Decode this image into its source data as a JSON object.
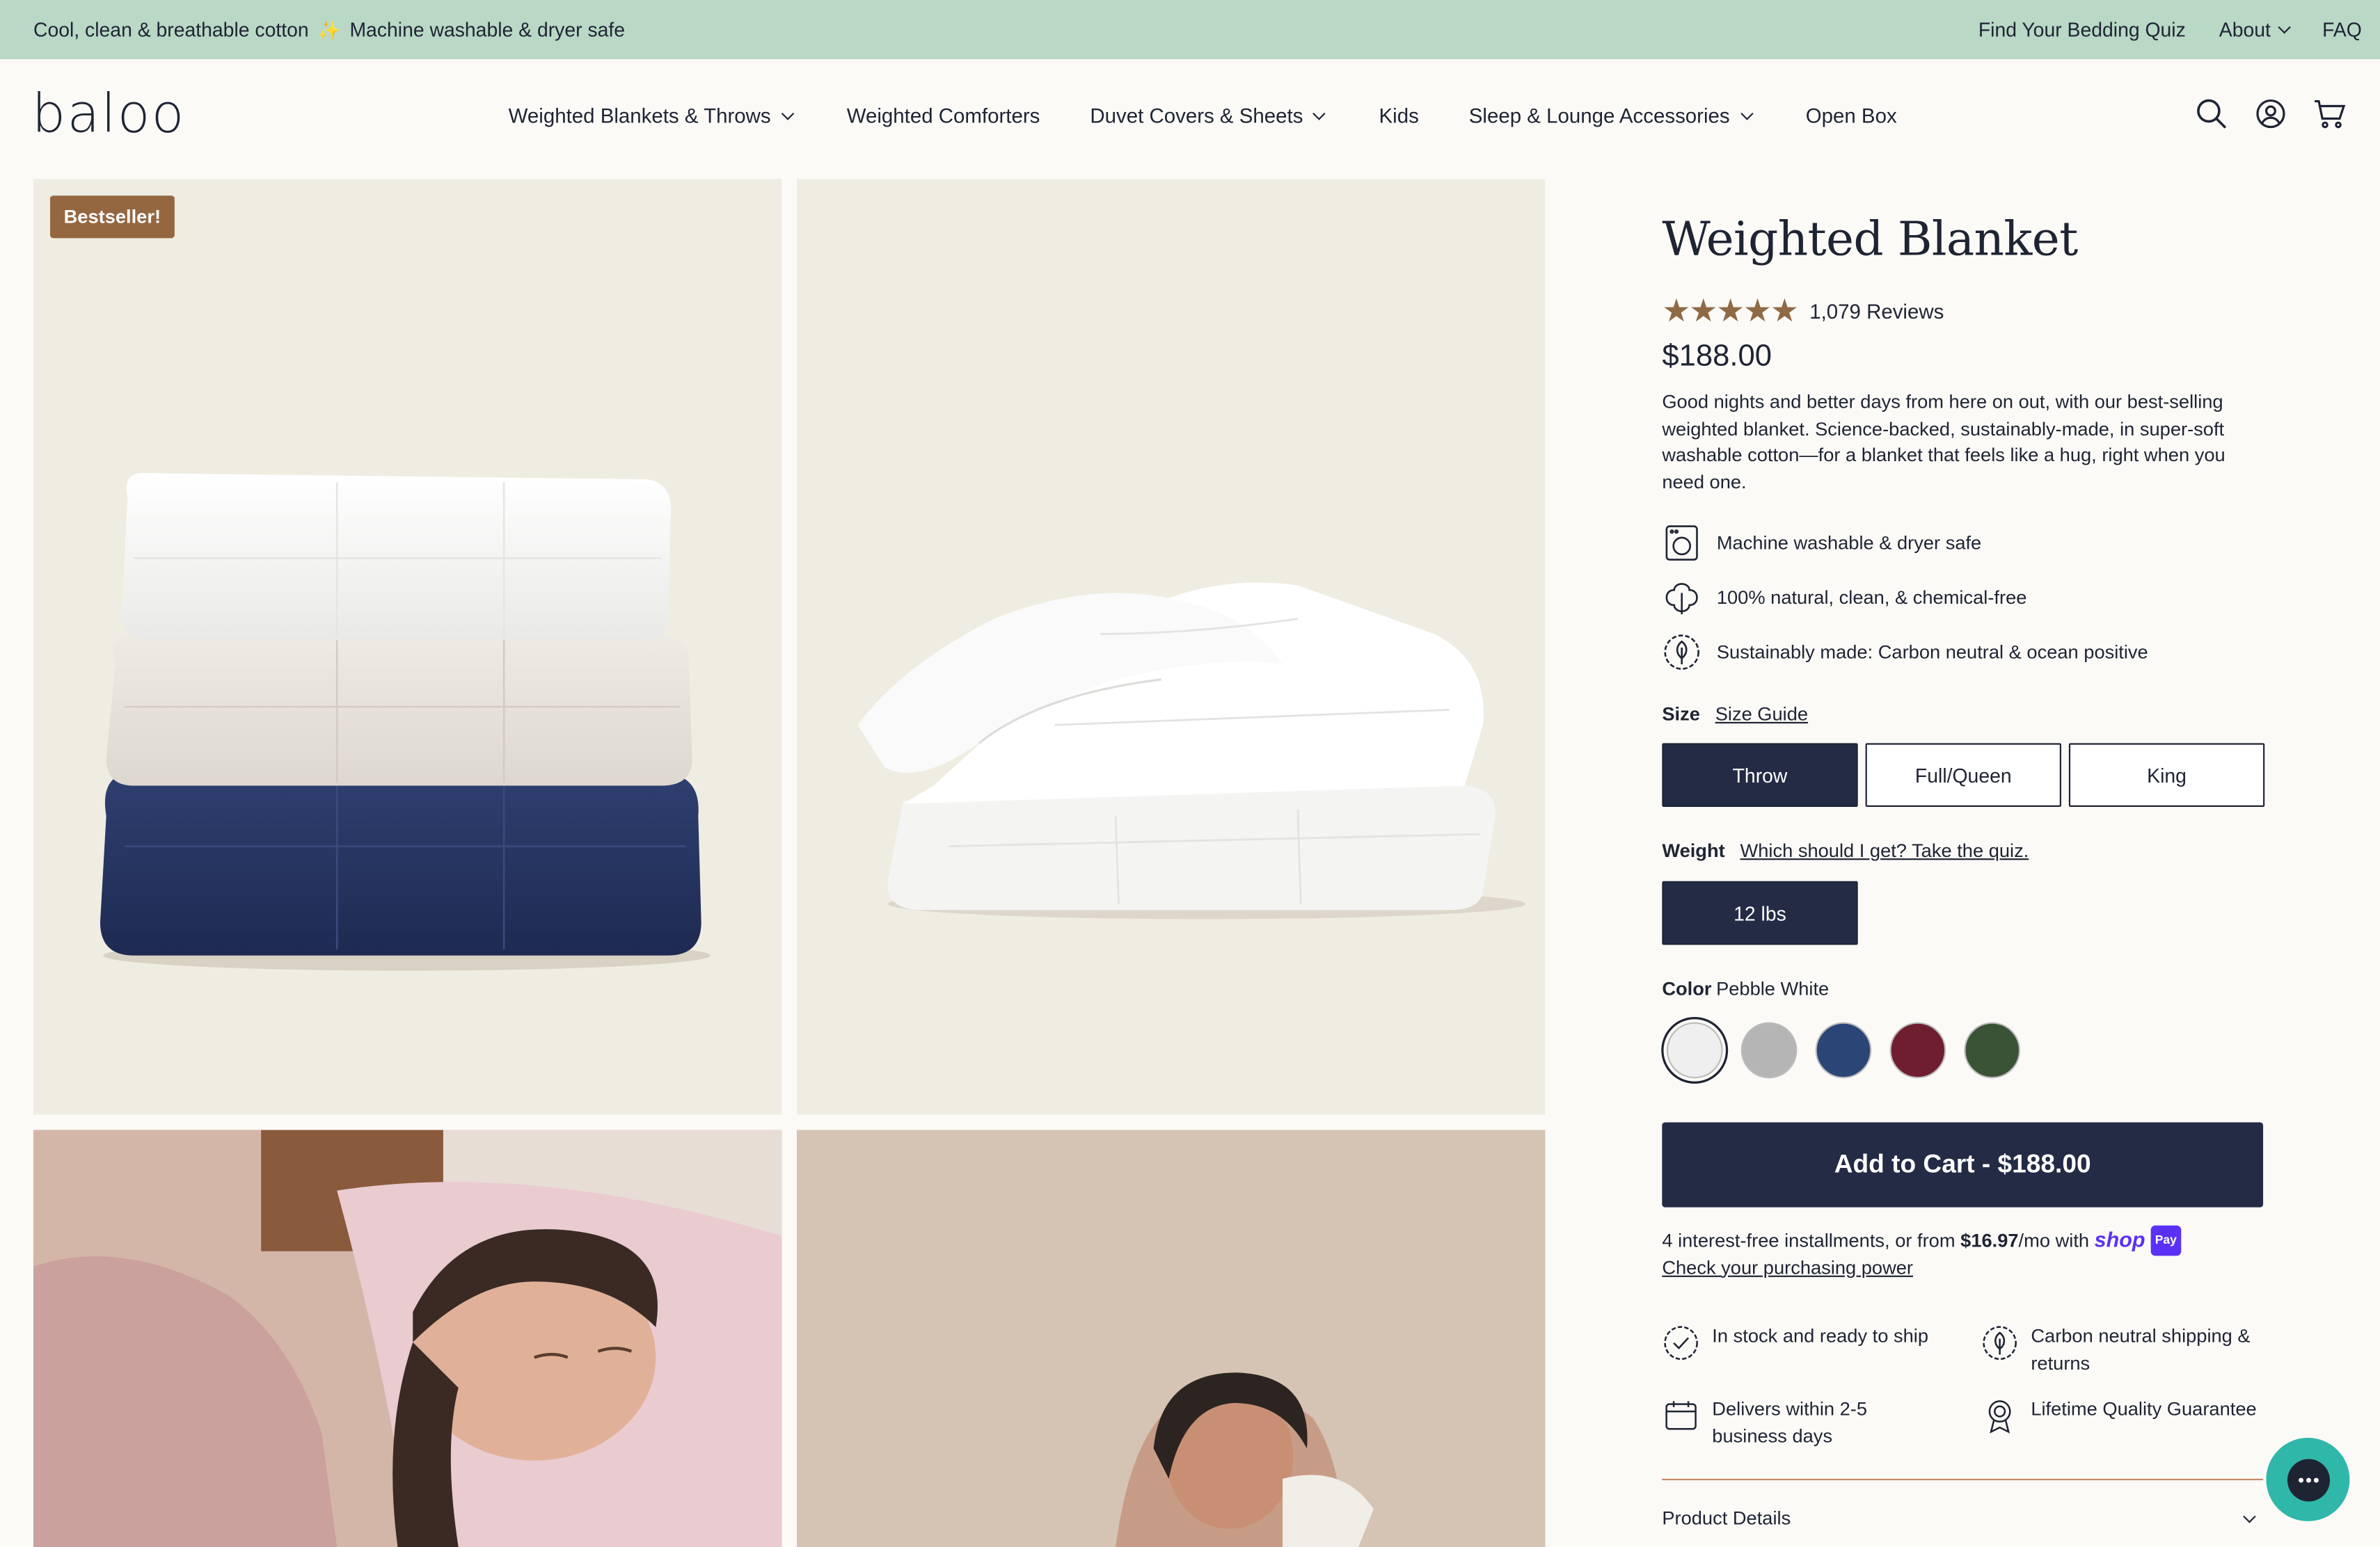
{
  "announcement": {
    "left_text_1": "Cool, clean & breathable cotton",
    "sparkle": "✨",
    "left_text_2": "Machine washable & dryer safe",
    "links": [
      "Find Your Bedding Quiz",
      "About",
      "FAQ"
    ]
  },
  "header": {
    "logo": "baloo",
    "nav": [
      {
        "label": "Weighted Blankets & Throws",
        "dropdown": true
      },
      {
        "label": "Weighted Comforters",
        "dropdown": false
      },
      {
        "label": "Duvet Covers & Sheets",
        "dropdown": true
      },
      {
        "label": "Kids",
        "dropdown": false
      },
      {
        "label": "Sleep & Lounge Accessories",
        "dropdown": true
      },
      {
        "label": "Open Box",
        "dropdown": false
      }
    ],
    "icons": [
      "search-icon",
      "account-icon",
      "cart-icon"
    ]
  },
  "gallery": {
    "badge": "Bestseller!"
  },
  "product": {
    "title": "Weighted Blanket",
    "stars": "★★★★★",
    "rating": 4.8,
    "reviews": "1,079 Reviews",
    "price": "$188.00",
    "description": "Good nights and better days from here on out, with our best-selling weighted blanket. Science-backed, sustainably-made, in super-soft washable cotton—for a blanket that feels like a hug, right when you need one.",
    "features": [
      "Machine washable & dryer safe",
      "100% natural, clean, & chemical-free",
      "Sustainably made: Carbon neutral & ocean positive"
    ],
    "size_label": "Size",
    "size_guide": "Size Guide",
    "sizes": [
      "Throw",
      "Full/Queen",
      "King"
    ],
    "selected_size": "Throw",
    "weight_label": "Weight",
    "weight_quiz": "Which should I get? Take the quiz.",
    "weights": [
      "12 lbs"
    ],
    "color_label": "Color",
    "color_value": "Pebble White",
    "colors": [
      "#efefef",
      "#b5b5b6",
      "#2c4577",
      "#6f1e30",
      "#3a5236"
    ],
    "add_to_cart": "Add to Cart - $188.00",
    "installments_pre": "4 interest-free installments, or from ",
    "installments_amount": "$16.97",
    "installments_post": "/mo with ",
    "shop": "shop",
    "pay": "Pay",
    "purchasing_power": "Check your purchasing power",
    "perks": [
      "In stock and ready to ship",
      "Carbon neutral shipping & returns",
      "Delivers within 2-5 business days",
      "Lifetime Quality Guarantee"
    ],
    "details": "Product Details"
  },
  "colors": {
    "announcement_bg": "#b9d8c6",
    "primary": "#232b45",
    "badge": "#946740",
    "star": "#8f6a45",
    "chat": "#2fb7a9",
    "shop_pay": "#5a31f4"
  }
}
